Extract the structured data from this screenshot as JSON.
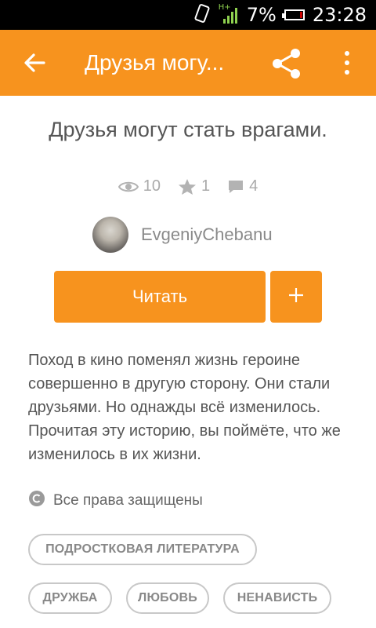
{
  "status_bar": {
    "network": "H+",
    "battery": "7%",
    "time": "23:28"
  },
  "app_bar": {
    "title": "Друзья могу..."
  },
  "story": {
    "title": "Друзья могут стать врагами.",
    "stats": {
      "views": "10",
      "stars": "1",
      "comments": "4"
    },
    "author": "EvgeniyChebanu",
    "read_label": "Читать",
    "add_label": "+",
    "description": "Поход в кино поменял жизнь героине совершенно в другую сторону. Они стали друзьями. Но однажды всё изменилось. Прочитая эту историю, вы поймёте, что же изменилось в их жизни.",
    "copyright": "Все права защищены",
    "tags": [
      "ПОДРОСТКОВАЯ ЛИТЕРАТУРА",
      "ДРУЖБА",
      "ЛЮБОВЬ",
      "НЕНАВИСТЬ"
    ]
  },
  "colors": {
    "accent": "#f7931e",
    "text": "#555555",
    "muted": "#aaaaaa"
  },
  "icons": [
    "back-arrow-icon",
    "share-icon",
    "more-vert-icon",
    "eye-icon",
    "star-icon",
    "comment-icon",
    "copyright-icon",
    "vibrate-icon",
    "signal-icon",
    "battery-icon"
  ]
}
